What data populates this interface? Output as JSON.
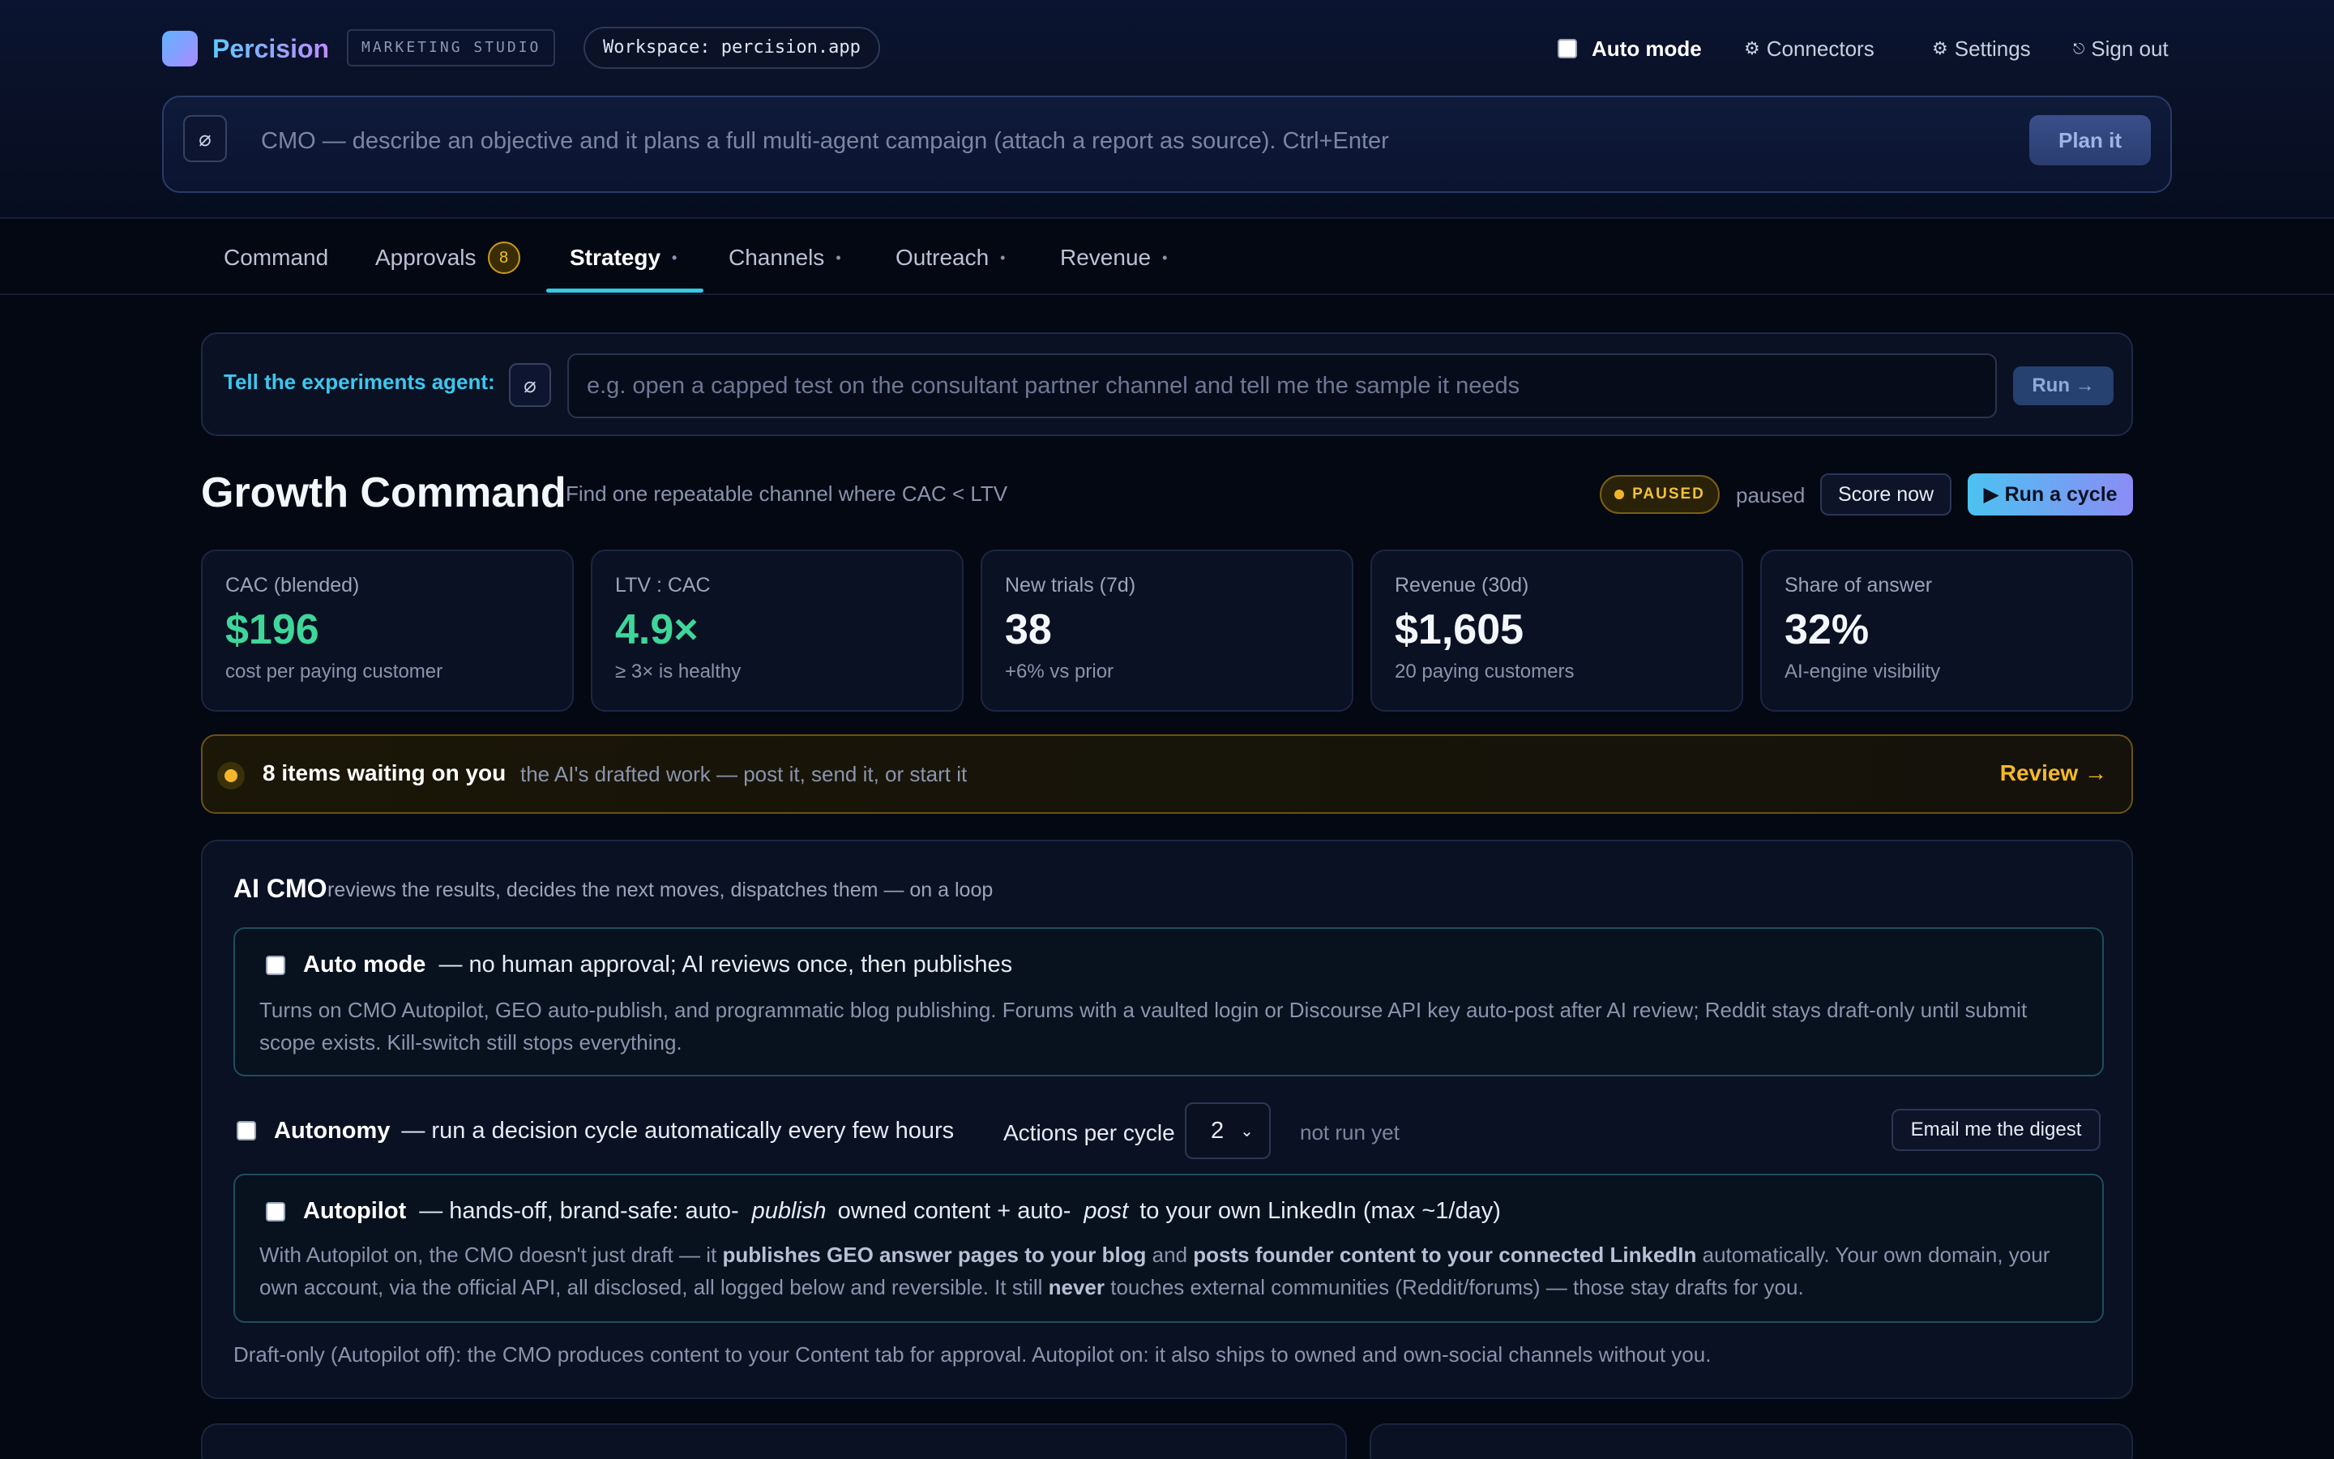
{
  "header": {
    "brand": "Percision",
    "studio_badge": "MARKETING STUDIO",
    "workspace": "Workspace: percision.app",
    "auto_mode_label": "Auto mode",
    "connectors_label": "Connectors",
    "settings_label": "Settings",
    "signout_label": "Sign out",
    "connectors_icon": "⚙",
    "settings_icon": "⚙",
    "signout_icon": "⎋"
  },
  "command_bar": {
    "placeholder": "CMO — describe an objective and it plans a full multi-agent campaign (attach a report as source). Ctrl+Enter",
    "plan_label": "Plan it"
  },
  "tabs": [
    {
      "label": "Command"
    },
    {
      "label": "Approvals",
      "badge": "8"
    },
    {
      "label": "Strategy",
      "active": true
    },
    {
      "label": "Channels"
    },
    {
      "label": "Outreach"
    },
    {
      "label": "Revenue"
    }
  ],
  "tab_dot": "•",
  "agent": {
    "label": "Tell the experiments agent:",
    "placeholder": "e.g. open a capped test on the consultant partner channel and tell me the sample it needs",
    "run_label": "Run →"
  },
  "growth": {
    "title": "Growth Command",
    "subtitle": "Find one repeatable channel where CAC < LTV",
    "status_pill": "PAUSED",
    "status_text": "paused",
    "score_label": "Score now",
    "cycle_label": "▶ Run a cycle"
  },
  "kpis": [
    {
      "label": "CAC (blended)",
      "value": "$196",
      "hint": "cost per paying customer",
      "accent": "green"
    },
    {
      "label": "LTV : CAC",
      "value": "4.9×",
      "hint": "≥ 3× is healthy",
      "accent": "green"
    },
    {
      "label": "New trials (7d)",
      "value": "38",
      "hint": "+6% vs prior",
      "accent": "white"
    },
    {
      "label": "Revenue (30d)",
      "value": "$1,605",
      "hint": "20 paying customers",
      "accent": "white"
    },
    {
      "label": "Share of answer",
      "value": "32%",
      "hint": "AI-engine visibility",
      "accent": "white"
    }
  ],
  "waiting": {
    "strong": "8 items waiting on you",
    "sub": "the AI's drafted work — post it, send it, or start it",
    "review_label": "Review →"
  },
  "cmo": {
    "title": "AI CMO",
    "subtitle": "reviews the results, decides the next moves, dispatches them — on a loop",
    "auto_mode": {
      "label": "Auto mode",
      "tail": "— no human approval; AI reviews once, then publishes",
      "desc1": "Turns on CMO Autopilot, GEO auto-publish, and programmatic blog publishing. Forums with a vaulted login or Discourse API key auto-post after AI review; Reddit stays draft-only until submit",
      "desc2": "scope exists. Kill-switch still stops everything."
    },
    "autonomy": {
      "label": "Autonomy",
      "tail": "— run a decision cycle automatically every few hours",
      "actions_label": "Actions per cycle",
      "actions_value": "2",
      "status": "not run yet",
      "digest_label": "Email me the digest"
    },
    "autopilot": {
      "label": "Autopilot",
      "tail_a": "— hands-off, brand-safe: auto-",
      "tail_b": "publish",
      "tail_c": "owned content + auto-",
      "tail_d": "post",
      "tail_e": "to your own LinkedIn (max ~1/day)",
      "d1a": "With Autopilot on, the CMO doesn't just draft — it ",
      "d1b": "publishes GEO answer pages to your blog",
      "d1c": " and ",
      "d1d": "posts founder content to your connected LinkedIn",
      "d1e": " automatically. Your own domain, your",
      "d2a": "own account, via the official API, all disclosed, all logged below and reversible. It still ",
      "d2b": "never",
      "d2c": " touches external communities (Reddit/forums) — those stay drafts for you."
    },
    "draft_note": "Draft-only (Autopilot off): the CMO produces content to your Content tab for approval. Autopilot on: it also ships to owned and own-social channels without you."
  },
  "colors": {
    "accent_cyan": "#36c9e6",
    "accent_green": "#3fd69a",
    "accent_amber": "#f5b82a",
    "background": "#040812"
  }
}
